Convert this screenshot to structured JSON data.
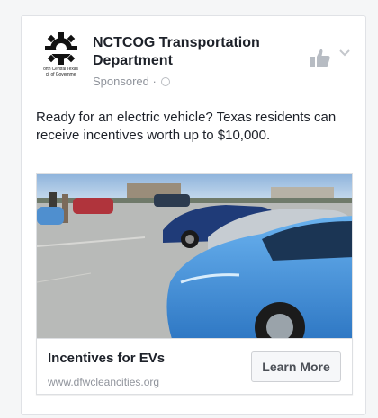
{
  "post": {
    "page_name": "NCTCOG Transportation Department",
    "sponsored": "Sponsored · ",
    "logo_caption": "orth Central Texas\ncil of Governme",
    "text": "Ready for an electric vehicle? Texas residents can receive incentives worth up to $10,000."
  },
  "link": {
    "title": "Incentives for EVs",
    "domain": "www.dfwcleancities.org",
    "cta_label": "Learn More"
  },
  "icons": {
    "logo": "nctcog-gear-logo",
    "like": "thumbs-up-icon",
    "menu": "chevron-down-icon",
    "privacy": "globe-icon"
  },
  "colors": {
    "text": "#1d2129",
    "muted": "#90949c",
    "car_blue": "#3f8fd8",
    "sky": "#a9c6e4"
  }
}
